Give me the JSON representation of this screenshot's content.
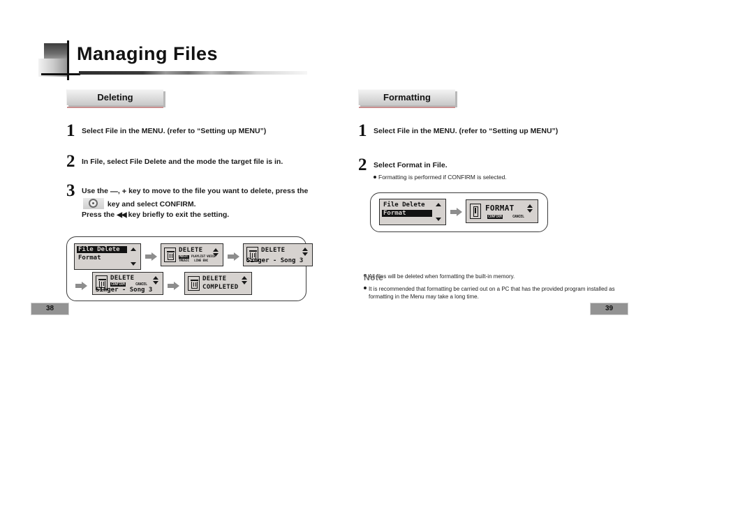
{
  "header": {
    "chapter_title": "Managing Files"
  },
  "left_column": {
    "section_label": "Deleting",
    "steps": [
      {
        "number": "1",
        "text": "Select File in the MENU. (refer to “Setting up MENU”)"
      },
      {
        "number": "2",
        "text": "In File, select File Delete and the mode the target file is in."
      },
      {
        "number": "3",
        "text_part1": "Use the",
        "key_minus": "—",
        "key_plus": "+",
        "text_part2": "key to move to the file you want to delete, press the",
        "nav_key_icon": "nav-key-icon",
        "text_part3": "key and select CONFIRM.",
        "text_part4": "Press the",
        "key_prev": "◀◀",
        "text_part5": "key briefly to exit the setting."
      }
    ],
    "screens": [
      {
        "id": "menu-file-delete",
        "line1": "File Delete",
        "line1_selected": true,
        "line2": "Format",
        "line2_selected": false,
        "scroll_up": "▲",
        "scroll_down": "▼"
      },
      {
        "id": "delete-mode-select",
        "icon": "trash-icon",
        "title": "DELETE",
        "options_row1": [
          "MUSIC",
          "PLAYLIST",
          "VOICE"
        ],
        "options_row1_selected": "MUSIC",
        "options_row2": [
          "TMUSIC",
          "LINE ENC"
        ]
      },
      {
        "id": "delete-file-select",
        "icon": "trash-icon",
        "title": "DELETE",
        "file_name": "Singer - Song 3"
      },
      {
        "id": "delete-confirm",
        "icon": "trash-icon",
        "title": "DELETE",
        "confirm_label": "CONFIRM",
        "confirm_selected": true,
        "cancel_label": "CANCEL",
        "file_name": "Singer - Song 3"
      },
      {
        "id": "delete-completed",
        "icon": "trash-icon",
        "title": "DELETE",
        "subtitle": "COMPLETED"
      }
    ]
  },
  "right_column": {
    "section_label": "Formatting",
    "steps": [
      {
        "number": "1",
        "text": "Select File in the MENU. (refer to “Setting up MENU”)"
      },
      {
        "number": "2",
        "text": "Select Format in File.",
        "sub_bullet": "Formatting is performed if CONFIRM is selected."
      }
    ],
    "screens": [
      {
        "id": "menu-format",
        "line1": "File Delete",
        "line1_selected": false,
        "line2": "Format",
        "line2_selected": true,
        "scroll_up": "▲",
        "scroll_down": "▼"
      },
      {
        "id": "format-confirm",
        "icon": "format-icon",
        "title": "FORMAT",
        "confirm_label": "CONFIRM",
        "confirm_selected": true,
        "cancel_label": "CANCEL"
      }
    ],
    "note": {
      "title": "Note",
      "items": [
        "All files will be deleted when formatting the built-in memory.",
        "It is recommended that formatting be carried out on a PC that has the provided program installed as",
        "formatting in the Menu may take a long time."
      ]
    }
  },
  "footer": {
    "page_left": "38",
    "page_right": "39"
  },
  "colors": {
    "lcd_background": "#d6d2cf",
    "lcd_text": "#111111",
    "tab_accent": "#c98f8f",
    "arrow_gray": "#8d8d8d",
    "page_box": "#939393"
  }
}
